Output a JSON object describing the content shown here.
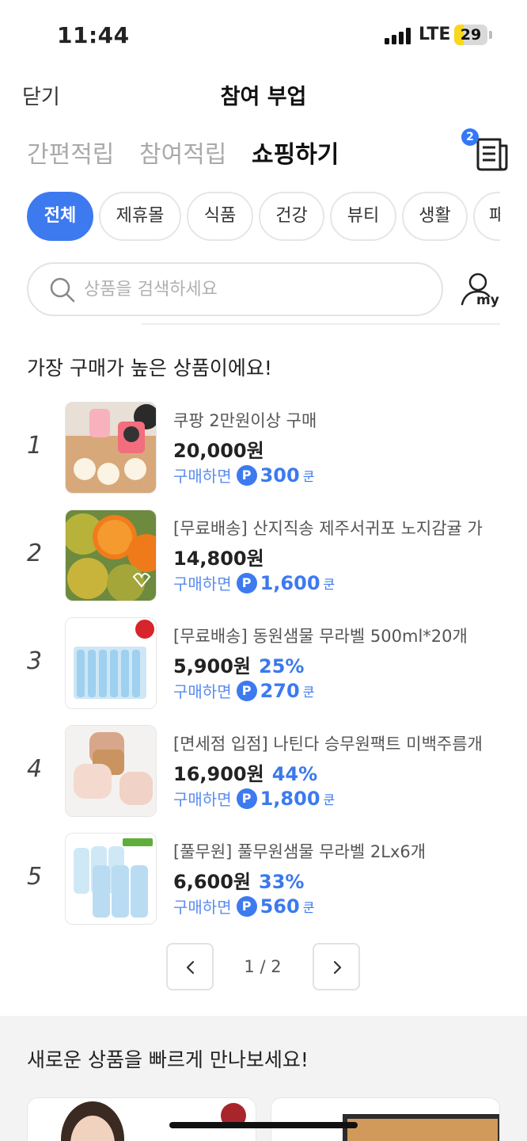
{
  "status_bar": {
    "time": "11:44",
    "network": "LTE",
    "battery": "29",
    "battery_level": 0.29
  },
  "header": {
    "close_label": "닫기",
    "title": "참여 부업"
  },
  "tabs": [
    {
      "label": "간편적립",
      "active": false
    },
    {
      "label": "참여적립",
      "active": false
    },
    {
      "label": "쇼핑하기",
      "active": true
    }
  ],
  "receipt": {
    "badge_count": "2",
    "icon": "receipt-icon"
  },
  "categories": [
    {
      "label": "전체",
      "active": true
    },
    {
      "label": "제휴몰",
      "active": false
    },
    {
      "label": "식품",
      "active": false
    },
    {
      "label": "건강",
      "active": false
    },
    {
      "label": "뷰티",
      "active": false
    },
    {
      "label": "생활",
      "active": false
    },
    {
      "label": "패",
      "active": false
    }
  ],
  "search": {
    "placeholder": "상품을 검색하세요",
    "icon": "search-icon"
  },
  "my_button": {
    "label": "my",
    "icon": "user-icon"
  },
  "best_section": {
    "title": "가장 구매가 높은 상품이에요!"
  },
  "products": [
    {
      "rank": "1",
      "name": "쿠팡 2만원이상 구매",
      "price": "20,000원",
      "discount": "",
      "reward_label": "구매하면",
      "point_icon": "P",
      "points": "300",
      "unit": "쿤"
    },
    {
      "rank": "2",
      "name": "[무료배송] 산지직송 제주서귀포 노지감귤 가",
      "price": "14,800원",
      "discount": "",
      "reward_label": "구매하면",
      "point_icon": "P",
      "points": "1,600",
      "unit": "쿤"
    },
    {
      "rank": "3",
      "name": "[무료배송] 동원샘물 무라벨 500ml*20개",
      "price": "5,900원",
      "discount": "25%",
      "reward_label": "구매하면",
      "point_icon": "P",
      "points": "270",
      "unit": "쿤"
    },
    {
      "rank": "4",
      "name": "[면세점 입점] 나틴다 승무원팩트 미백주름개",
      "price": "16,900원",
      "discount": "44%",
      "reward_label": "구매하면",
      "point_icon": "P",
      "points": "1,800",
      "unit": "쿤"
    },
    {
      "rank": "5",
      "name": "[풀무원] 풀무원샘물 무라벨 2Lx6개",
      "price": "6,600원",
      "discount": "33%",
      "reward_label": "구매하면",
      "point_icon": "P",
      "points": "560",
      "unit": "쿤"
    }
  ],
  "pagination": {
    "text": "1 / 2"
  },
  "new_section": {
    "title": "새로운 상품을 빠르게 만나보세요!"
  },
  "colors": {
    "accent": "#3d7af0",
    "reward": "#5b8cef",
    "muted": "#aaaaaa"
  }
}
